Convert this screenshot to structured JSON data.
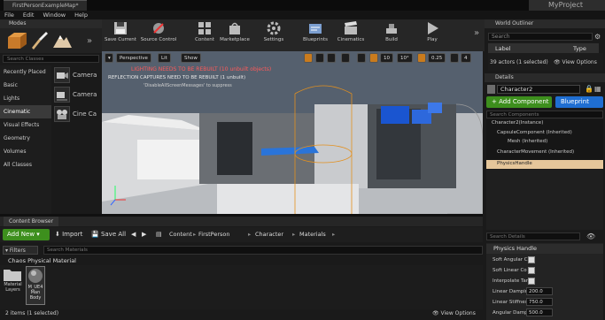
{
  "window": {
    "tab_title": "FirstPersonExampleMap*",
    "project_name": "MyProject"
  },
  "menu": [
    "File",
    "Edit",
    "Window",
    "Help"
  ],
  "modes": {
    "tab_label": "Modes",
    "search_placeholder": "Search Classes",
    "categories": [
      "Recently Placed",
      "Basic",
      "Lights",
      "Cinematic",
      "Visual Effects",
      "Geometry",
      "Volumes",
      "All Classes"
    ],
    "selected_category": "Cinematic",
    "items": [
      "Camera",
      "Camera",
      "Cine Ca"
    ]
  },
  "toolbar": {
    "buttons": [
      "Save Current",
      "Source Control",
      "Content",
      "Marketplace",
      "Settings",
      "Blueprints",
      "Cinematics",
      "Build",
      "Play"
    ]
  },
  "viewport": {
    "perspective_label": "Perspective",
    "lit_label": "Lit",
    "show_label": "Show",
    "grid_snap": "10",
    "rotation_snap": "10°",
    "scale_snap": "0.25",
    "camera_speed": "4",
    "warning_lighting": "LIGHTING NEEDS TO BE REBUILT (10 unbuilt objects)",
    "warning_reflection": "REFLECTION CAPTURES NEED TO BE REBUILT (1 unbuilt)",
    "hint_text": "'DisableAllScreenMessages' to suppress"
  },
  "outliner": {
    "tab_label": "World Outliner",
    "search_placeholder": "Search",
    "col_label": "Label",
    "col_type": "Type",
    "count_text": "39 actors (1 selected)",
    "view_options": "View Options"
  },
  "details": {
    "tab_label": "Details",
    "object_name": "Character2",
    "add_component": "+ Add Component",
    "blueprint": "Blueprint",
    "search_components": "Search Components",
    "components": [
      "Character2(Instance)",
      "CapsuleComponent (Inherited)",
      "Mesh (Inherited)",
      "CharacterMovement (Inherited)",
      "PhysicsHandle"
    ],
    "search_details": "Search Details",
    "section": "Physics Handle",
    "props": [
      {
        "label": "Soft Angular C"
      },
      {
        "label": "Soft Linear Co"
      },
      {
        "label": "Interpolate Tar"
      },
      {
        "label": "Linear Dampin",
        "value": "200.0"
      },
      {
        "label": "Linear Stiffnes",
        "value": "750.0"
      },
      {
        "label": "Angular Dampi",
        "value": "500.0"
      }
    ]
  },
  "content_browser": {
    "tab_label": "Content Browser",
    "add_new": "Add New",
    "import": "Import",
    "save_all": "Save All",
    "breadcrumb": [
      "Content",
      "FirstPerson",
      "Character",
      "Materials"
    ],
    "filters": "Filters",
    "search_placeholder": "Search Materials",
    "filter_chip": "Chaos Physical Material",
    "folder_label": "Material Layers",
    "asset_label": "M_UE4 Man Body",
    "status": "2 items (1 selected)",
    "view_options": "View Options"
  }
}
